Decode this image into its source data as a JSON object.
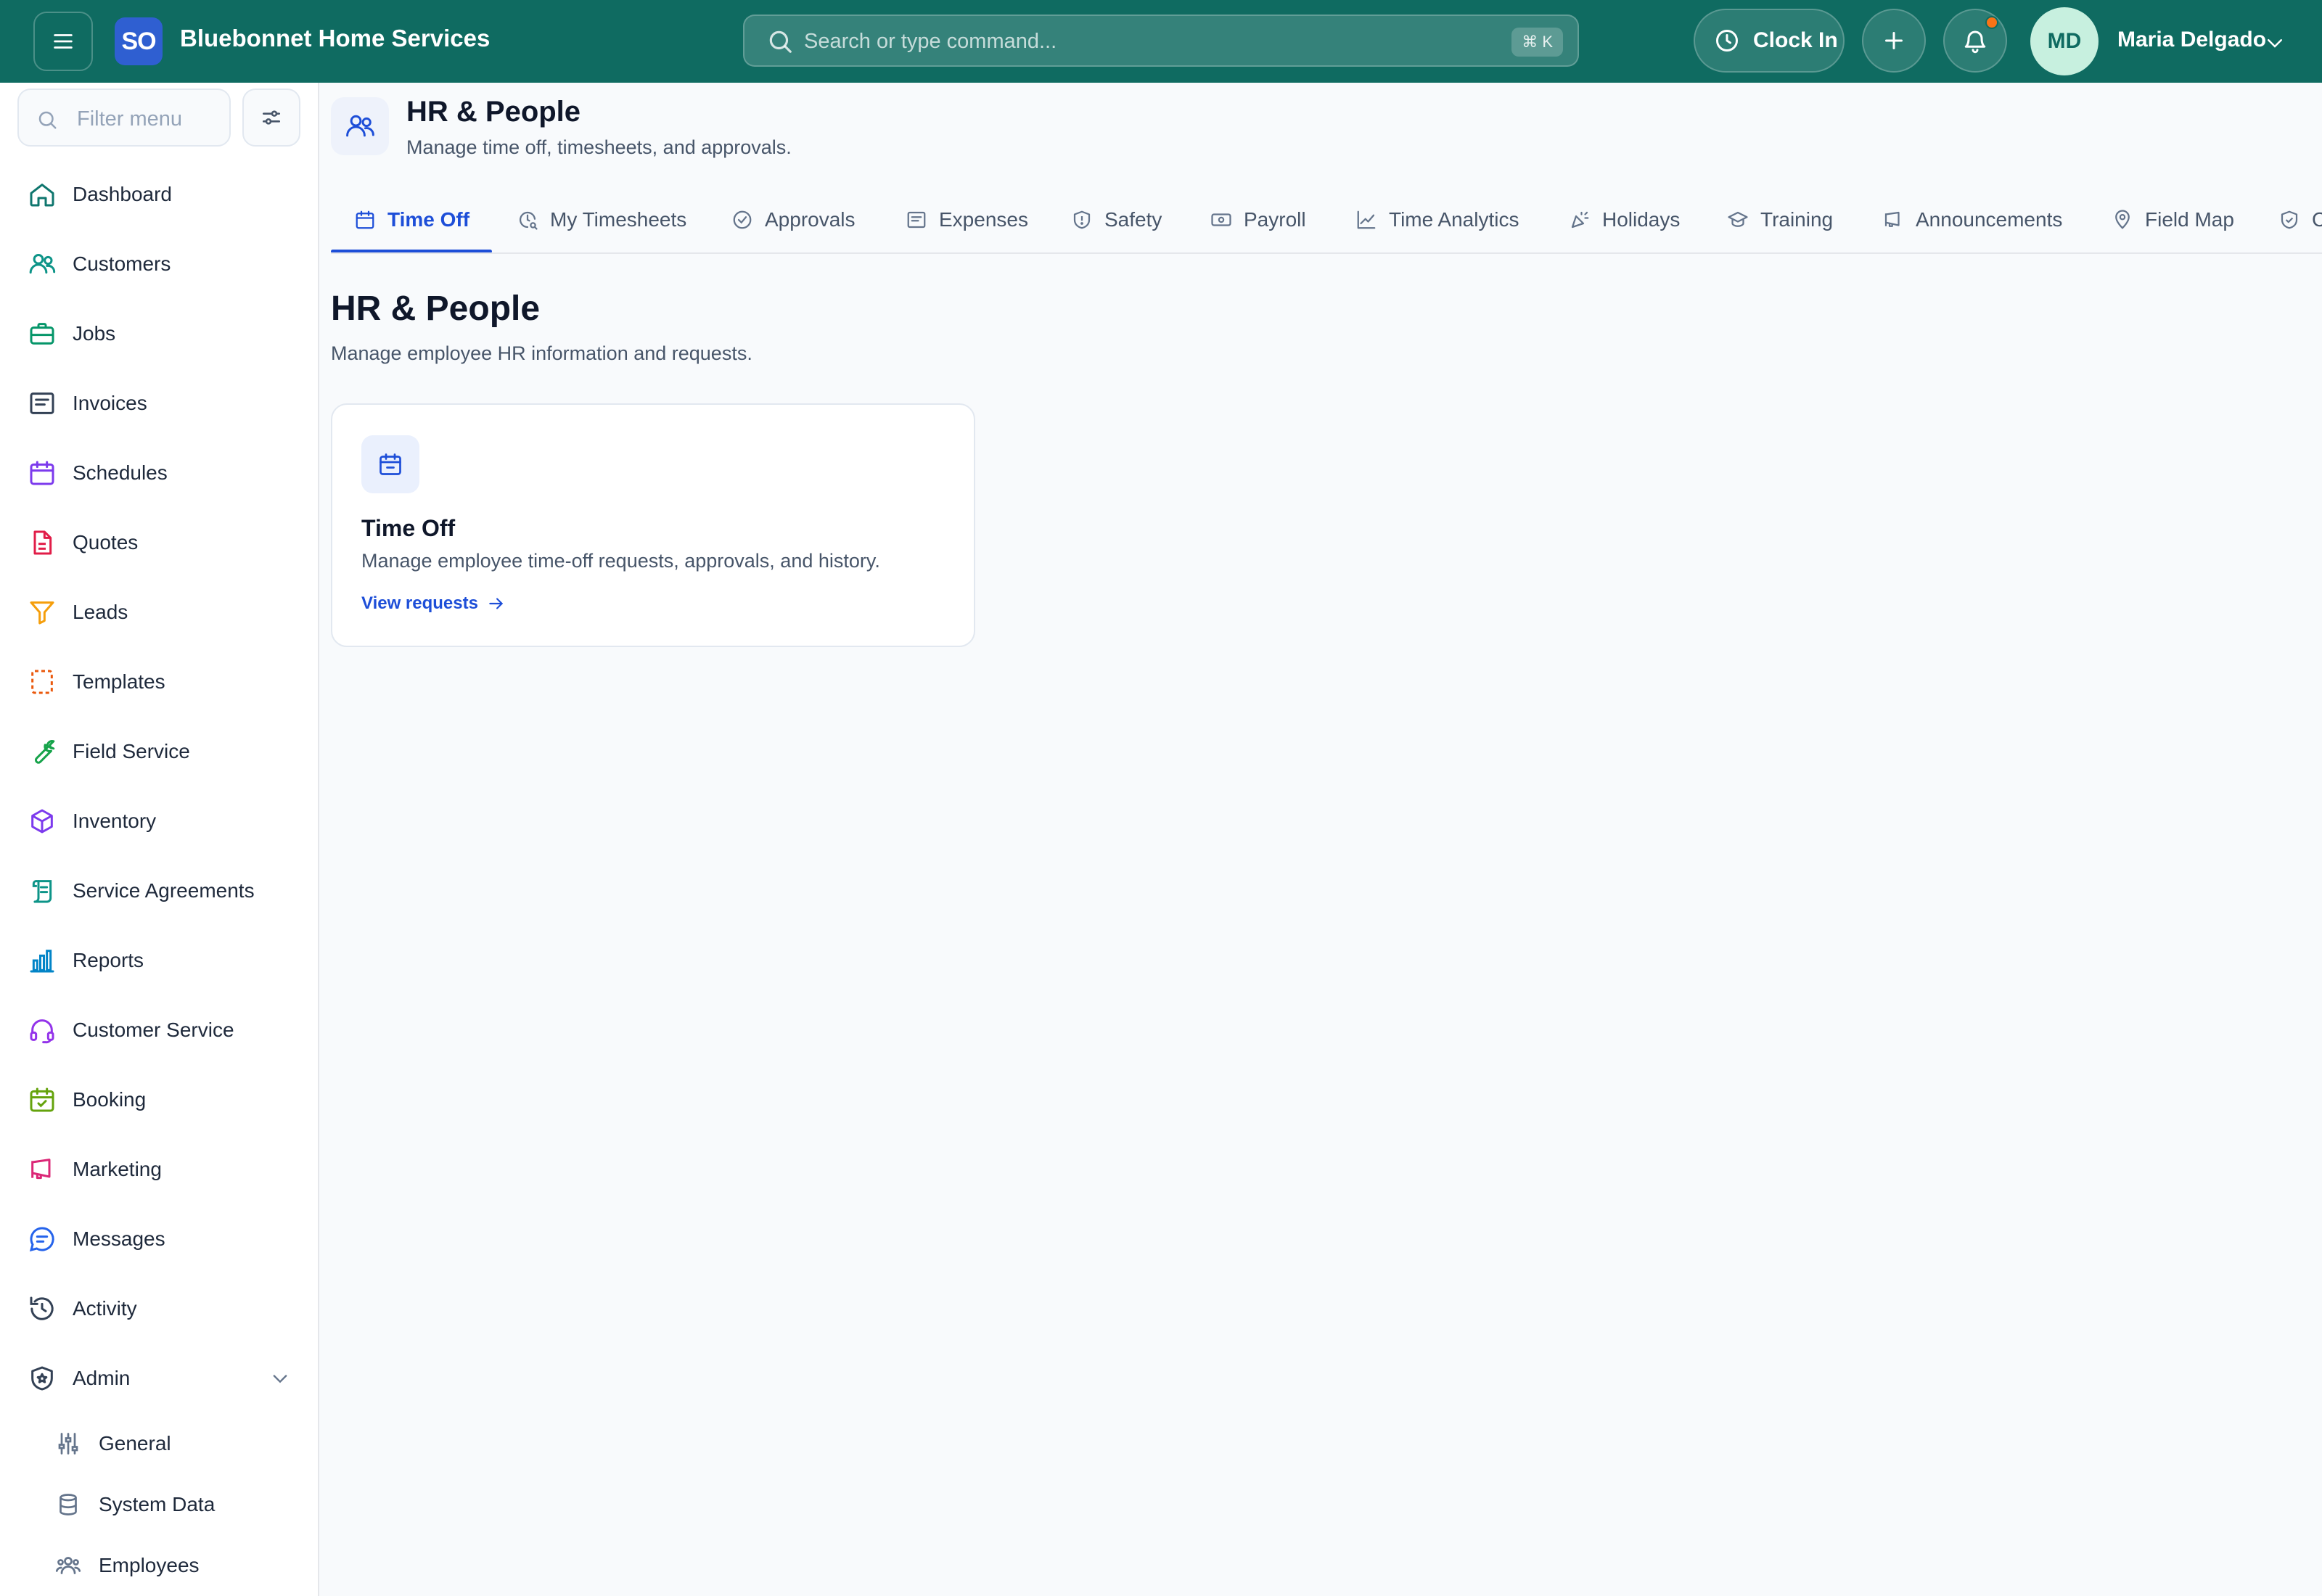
{
  "app": {
    "logo_text": "SO",
    "brand": "Bluebonnet Home Services"
  },
  "search": {
    "placeholder": "Search or type command...",
    "shortcut": "⌘ K"
  },
  "header": {
    "clock_in_label": "Clock In",
    "notification_dot_color": "#f97316",
    "user_initials": "MD",
    "user_name": "Maria Delgado"
  },
  "sidebar": {
    "filter_placeholder": "Filter menu",
    "items": [
      {
        "label": "Dashboard",
        "icon": "home-icon",
        "color": "#0f766e"
      },
      {
        "label": "Customers",
        "icon": "users-icon",
        "color": "#0d9488"
      },
      {
        "label": "Jobs",
        "icon": "briefcase-icon",
        "color": "#059669"
      },
      {
        "label": "Invoices",
        "icon": "invoice-icon",
        "color": "#334155"
      },
      {
        "label": "Schedules",
        "icon": "calendar-icon",
        "color": "#7c3aed"
      },
      {
        "label": "Quotes",
        "icon": "document-icon",
        "color": "#e11d48"
      },
      {
        "label": "Leads",
        "icon": "funnel-icon",
        "color": "#f59e0b"
      },
      {
        "label": "Templates",
        "icon": "template-icon",
        "color": "#ea580c"
      },
      {
        "label": "Field Service",
        "icon": "wrench-icon",
        "color": "#16a34a"
      },
      {
        "label": "Inventory",
        "icon": "box-icon",
        "color": "#7c3aed"
      },
      {
        "label": "Service Agreements",
        "icon": "scroll-icon",
        "color": "#0d9488"
      },
      {
        "label": "Reports",
        "icon": "bar-chart-icon",
        "color": "#0284c7"
      },
      {
        "label": "Customer Service",
        "icon": "headset-icon",
        "color": "#9333ea"
      },
      {
        "label": "Booking",
        "icon": "calendar-check-icon",
        "color": "#65a30d"
      },
      {
        "label": "Marketing",
        "icon": "megaphone-icon",
        "color": "#db2777"
      },
      {
        "label": "Messages",
        "icon": "chat-icon",
        "color": "#2563eb"
      },
      {
        "label": "Activity",
        "icon": "history-icon",
        "color": "#334155"
      },
      {
        "label": "Admin",
        "icon": "shield-star-icon",
        "color": "#334155"
      }
    ],
    "admin_subitems": [
      {
        "label": "General",
        "icon": "sliders-icon"
      },
      {
        "label": "System Data",
        "icon": "database-icon"
      },
      {
        "label": "Employees",
        "icon": "people-icon"
      }
    ]
  },
  "page": {
    "title": "HR & People",
    "subtitle": "Manage time off, timesheets, and approvals.",
    "tabs": [
      {
        "label": "Time Off",
        "icon": "calendar-icon",
        "active": true
      },
      {
        "label": "My Timesheets",
        "icon": "clock-search-icon"
      },
      {
        "label": "Approvals",
        "icon": "check-circle-icon"
      },
      {
        "label": "Expenses",
        "icon": "receipt-icon"
      },
      {
        "label": "Safety",
        "icon": "shield-icon"
      },
      {
        "label": "Payroll",
        "icon": "banknote-icon"
      },
      {
        "label": "Time Analytics",
        "icon": "line-chart-icon"
      },
      {
        "label": "Holidays",
        "icon": "party-icon"
      },
      {
        "label": "Training",
        "icon": "graduation-cap-icon"
      },
      {
        "label": "Announcements",
        "icon": "megaphone-icon"
      },
      {
        "label": "Field Map",
        "icon": "map-pin-icon"
      },
      {
        "label": "C",
        "icon": "shield-check-icon"
      }
    ]
  },
  "section": {
    "title": "HR & People",
    "subtitle": "Manage employee HR information and requests."
  },
  "card": {
    "title": "Time Off",
    "description": "Manage employee time-off requests, approvals, and history.",
    "link": "View requests"
  }
}
